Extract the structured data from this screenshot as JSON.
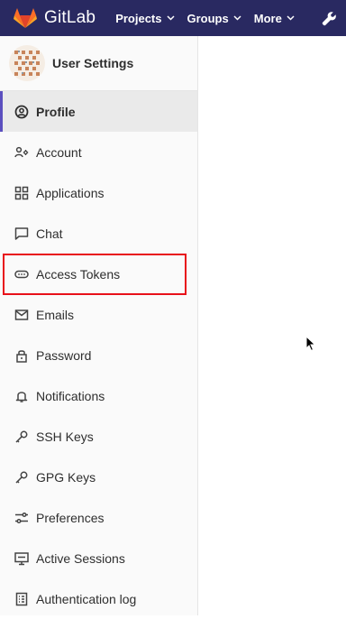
{
  "header": {
    "brand": "GitLab",
    "nav": [
      {
        "label": "Projects"
      },
      {
        "label": "Groups"
      },
      {
        "label": "More"
      }
    ],
    "colors": {
      "bar": "#292961",
      "logo_primary": "#fc6d26",
      "logo_secondary": "#e24329"
    }
  },
  "sidebar": {
    "title": "User Settings",
    "active_item": "Profile",
    "items": [
      {
        "label": "Profile",
        "icon": "user-circle-icon"
      },
      {
        "label": "Account",
        "icon": "account-icon"
      },
      {
        "label": "Applications",
        "icon": "applications-icon"
      },
      {
        "label": "Chat",
        "icon": "chat-icon"
      },
      {
        "label": "Access Tokens",
        "icon": "token-icon"
      },
      {
        "label": "Emails",
        "icon": "mail-icon"
      },
      {
        "label": "Password",
        "icon": "lock-icon"
      },
      {
        "label": "Notifications",
        "icon": "bell-icon"
      },
      {
        "label": "SSH Keys",
        "icon": "key-icon"
      },
      {
        "label": "GPG Keys",
        "icon": "key-icon"
      },
      {
        "label": "Preferences",
        "icon": "preferences-icon"
      },
      {
        "label": "Active Sessions",
        "icon": "monitor-icon"
      },
      {
        "label": "Authentication log",
        "icon": "log-icon"
      }
    ]
  },
  "annotation": {
    "highlight_color": "#e8101a"
  }
}
